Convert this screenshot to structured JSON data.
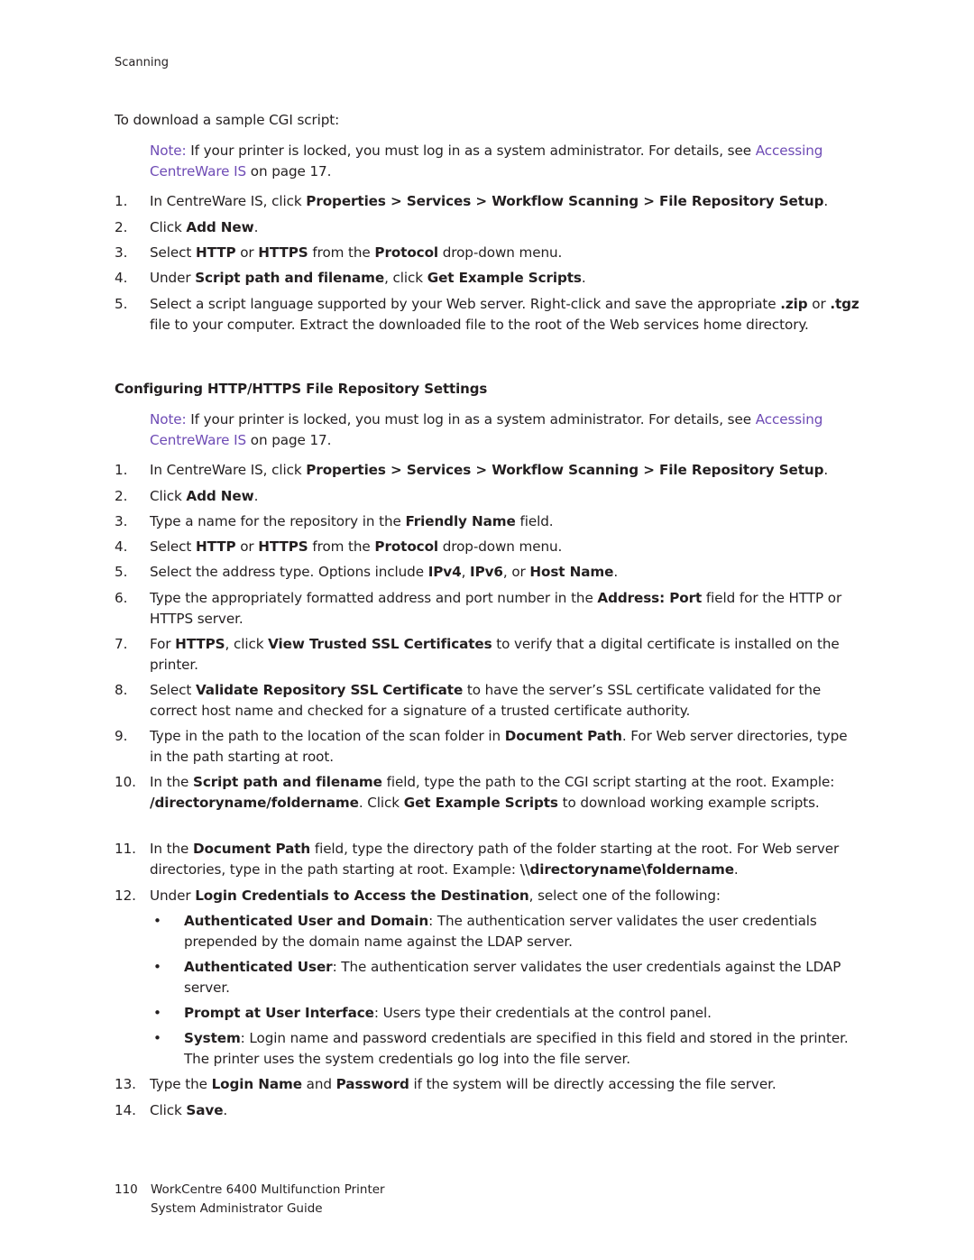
{
  "header": {
    "section": "Scanning"
  },
  "intro": "To download a sample CGI script:",
  "note1": {
    "label": "Note:",
    "text": " If your printer is locked, you must log in as a system administrator. For details, see ",
    "link": "Accessing CentreWare IS",
    "suffix": " on page 17."
  },
  "steps1": [
    {
      "n": "1.",
      "parts": [
        [
          "In CentreWare IS, click ",
          0
        ],
        [
          "Properties > Services > Workflow Scanning > File Repository Setup",
          1
        ],
        [
          ".",
          0
        ]
      ]
    },
    {
      "n": "2.",
      "parts": [
        [
          "Click ",
          0
        ],
        [
          "Add New",
          1
        ],
        [
          ".",
          0
        ]
      ]
    },
    {
      "n": "3.",
      "parts": [
        [
          "Select ",
          0
        ],
        [
          "HTTP",
          1
        ],
        [
          " or ",
          0
        ],
        [
          "HTTPS",
          1
        ],
        [
          " from the ",
          0
        ],
        [
          "Protocol",
          1
        ],
        [
          " drop-down menu.",
          0
        ]
      ]
    },
    {
      "n": "4.",
      "parts": [
        [
          "Under ",
          0
        ],
        [
          "Script path and filename",
          1
        ],
        [
          ", click ",
          0
        ],
        [
          "Get Example Scripts",
          1
        ],
        [
          ".",
          0
        ]
      ]
    },
    {
      "n": "5.",
      "parts": [
        [
          "Select a script language supported by your Web server. Right-click and save the appropriate ",
          0
        ],
        [
          ".zip",
          1
        ],
        [
          " or ",
          0
        ],
        [
          ".tgz",
          1
        ],
        [
          " file to your computer. Extract the downloaded file to the root of the Web services home directory.",
          0
        ]
      ]
    }
  ],
  "section_heading": "Configuring HTTP/HTTPS File Repository Settings",
  "note2": {
    "label": "Note:",
    "text": " If your printer is locked, you must log in as a system administrator. For details, see ",
    "link": "Accessing CentreWare IS",
    "suffix": " on page 17."
  },
  "steps2": [
    {
      "n": "1.",
      "parts": [
        [
          "In CentreWare IS, click ",
          0
        ],
        [
          "Properties > Services > Workflow Scanning > File Repository Setup",
          1
        ],
        [
          ".",
          0
        ]
      ]
    },
    {
      "n": "2.",
      "parts": [
        [
          "Click ",
          0
        ],
        [
          "Add New",
          1
        ],
        [
          ".",
          0
        ]
      ]
    },
    {
      "n": "3.",
      "parts": [
        [
          "Type a name for the repository in the ",
          0
        ],
        [
          "Friendly Name",
          1
        ],
        [
          " field.",
          0
        ]
      ]
    },
    {
      "n": "4.",
      "parts": [
        [
          "Select ",
          0
        ],
        [
          "HTTP",
          1
        ],
        [
          " or ",
          0
        ],
        [
          "HTTPS",
          1
        ],
        [
          " from the ",
          0
        ],
        [
          "Protocol",
          1
        ],
        [
          " drop-down menu.",
          0
        ]
      ]
    },
    {
      "n": "5.",
      "parts": [
        [
          "Select the address type. Options include ",
          0
        ],
        [
          "IPv4",
          1
        ],
        [
          ", ",
          0
        ],
        [
          "IPv6",
          1
        ],
        [
          ", or ",
          0
        ],
        [
          "Host Name",
          1
        ],
        [
          ".",
          0
        ]
      ]
    },
    {
      "n": "6.",
      "parts": [
        [
          "Type the appropriately formatted address and port number in the ",
          0
        ],
        [
          "Address: Port",
          1
        ],
        [
          " field for the HTTP or HTTPS server.",
          0
        ]
      ]
    },
    {
      "n": "7.",
      "parts": [
        [
          "For ",
          0
        ],
        [
          "HTTPS",
          1
        ],
        [
          ", click ",
          0
        ],
        [
          "View Trusted SSL Certificates",
          1
        ],
        [
          " to verify that a digital certificate is installed on the printer.",
          0
        ]
      ]
    },
    {
      "n": "8.",
      "parts": [
        [
          "Select ",
          0
        ],
        [
          "Validate Repository SSL Certificate",
          1
        ],
        [
          " to have the server’s SSL certificate validated for the correct host name and checked for a signature of a trusted certificate authority.",
          0
        ]
      ]
    },
    {
      "n": "9.",
      "parts": [
        [
          "Type in the path to the location of the scan folder in ",
          0
        ],
        [
          "Document Path",
          1
        ],
        [
          ". For Web server directories, type in the path starting at root.",
          0
        ]
      ]
    },
    {
      "n": "10.",
      "parts": [
        [
          "In the ",
          0
        ],
        [
          "Script path and filename",
          1
        ],
        [
          " field, type the path to the CGI script starting at the root. Example: ",
          0
        ],
        [
          "/directoryname/foldername",
          1
        ],
        [
          ". Click ",
          0
        ],
        [
          "Get Example Scripts",
          1
        ],
        [
          " to download working example scripts.",
          0
        ]
      ]
    },
    {
      "n": "11.",
      "parts": [
        [
          "In the ",
          0
        ],
        [
          "Document Path",
          1
        ],
        [
          " field, type the directory path of the folder starting at the root. For Web server directories, type in the path starting at root. Example: ",
          0
        ],
        [
          "\\\\directoryname\\foldername",
          1
        ],
        [
          ".",
          0
        ]
      ]
    },
    {
      "n": "12.",
      "parts": [
        [
          "Under ",
          0
        ],
        [
          "Login Credentials to Access the Destination",
          1
        ],
        [
          ", select one of the following:",
          0
        ]
      ]
    }
  ],
  "bullets": [
    {
      "parts": [
        [
          "Authenticated User and Domain",
          1
        ],
        [
          ": The authentication server validates the user credentials prepended by the domain name against the LDAP server.",
          0
        ]
      ]
    },
    {
      "parts": [
        [
          "Authenticated User",
          1
        ],
        [
          ": The authentication server validates the user credentials against the LDAP server.",
          0
        ]
      ]
    },
    {
      "parts": [
        [
          "Prompt at User Interface",
          1
        ],
        [
          ": Users type their credentials at the control panel.",
          0
        ]
      ]
    },
    {
      "parts": [
        [
          "System",
          1
        ],
        [
          ": Login name and password credentials are specified in this field and stored in the printer. The printer uses the system credentials go log into the file server.",
          0
        ]
      ]
    }
  ],
  "steps3": [
    {
      "n": "13.",
      "parts": [
        [
          "Type the ",
          0
        ],
        [
          "Login Name",
          1
        ],
        [
          " and ",
          0
        ],
        [
          "Password",
          1
        ],
        [
          " if the system will be directly accessing the file server.",
          0
        ]
      ]
    },
    {
      "n": "14.",
      "parts": [
        [
          "Click ",
          0
        ],
        [
          "Save",
          1
        ],
        [
          ".",
          0
        ]
      ]
    }
  ],
  "bullet_glyph": "•",
  "footer": {
    "page_number": "110",
    "line1": "WorkCentre 6400 Multifunction Printer",
    "line2": "System Administrator Guide"
  },
  "colors": {
    "accent_purple": "#6e4bb5",
    "text": "#231f20"
  }
}
